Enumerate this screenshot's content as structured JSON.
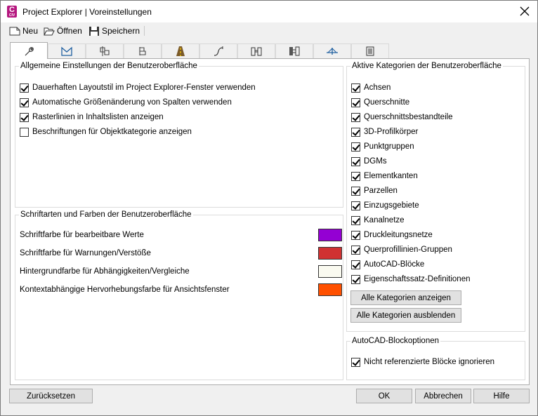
{
  "window": {
    "title": "Project Explorer | Voreinstellungen"
  },
  "toolbar": {
    "new_label": "Neu",
    "open_label": "Öffnen",
    "save_label": "Speichern"
  },
  "general": {
    "legend": "Allgemeine Einstellungen der Benutzeroberfläche",
    "options": [
      {
        "label": "Dauerhaften Layoutstil im Project Explorer-Fenster verwenden",
        "checked": true
      },
      {
        "label": "Automatische Größenänderung von Spalten verwenden",
        "checked": true
      },
      {
        "label": "Rasterlinien in Inhaltslisten anzeigen",
        "checked": true
      },
      {
        "label": "Beschriftungen für Objektkategorie anzeigen",
        "checked": false
      }
    ]
  },
  "fonts_colors": {
    "legend": "Schriftarten und Farben der Benutzeroberfläche",
    "rows": [
      {
        "label": "Schriftfarbe für bearbeitbare Werte",
        "color": "#9400d3"
      },
      {
        "label": "Schriftfarbe für Warnungen/Verstöße",
        "color": "#d03232"
      },
      {
        "label": "Hintergrundfarbe für Abhängigkeiten/Vergleiche",
        "color": "#fafaf0"
      },
      {
        "label": "Kontextabhängige Hervorhebungsfarbe für Ansichtsfenster",
        "color": "#ff5000"
      }
    ]
  },
  "categories": {
    "legend": "Aktive Kategorien der Benutzeroberfläche",
    "items": [
      {
        "label": "Achsen",
        "checked": true
      },
      {
        "label": "Querschnitte",
        "checked": true
      },
      {
        "label": "Querschnittsbestandteile",
        "checked": true
      },
      {
        "label": "3D-Profilkörper",
        "checked": true
      },
      {
        "label": "Punktgruppen",
        "checked": true
      },
      {
        "label": "DGMs",
        "checked": true
      },
      {
        "label": "Elementkanten",
        "checked": true
      },
      {
        "label": "Parzellen",
        "checked": true
      },
      {
        "label": "Einzugsgebiete",
        "checked": true
      },
      {
        "label": "Kanalnetze",
        "checked": true
      },
      {
        "label": "Druckleitungsnetze",
        "checked": true
      },
      {
        "label": "Querprofillinien-Gruppen",
        "checked": true
      },
      {
        "label": "AutoCAD-Blöcke",
        "checked": true
      },
      {
        "label": "Eigenschaftssatz-Definitionen",
        "checked": true
      }
    ],
    "show_all_label": "Alle Kategorien anzeigen",
    "hide_all_label": "Alle Kategorien ausblenden"
  },
  "block_options": {
    "legend": "AutoCAD-Blockoptionen",
    "options": [
      {
        "label": "Nicht referenzierte Blöcke ignorieren",
        "checked": true
      }
    ]
  },
  "footer": {
    "reset_label": "Zurücksetzen",
    "ok_label": "OK",
    "cancel_label": "Abbrechen",
    "help_label": "Hilfe"
  },
  "tabs": [
    {
      "icon": "wrench-icon"
    },
    {
      "icon": "surface-icon"
    },
    {
      "icon": "points-icon"
    },
    {
      "icon": "parcel-icon"
    },
    {
      "icon": "corridor-icon"
    },
    {
      "icon": "alignment-icon"
    },
    {
      "icon": "pipe-network-icon"
    },
    {
      "icon": "pressure-network-icon"
    },
    {
      "icon": "section-icon"
    },
    {
      "icon": "table-icon"
    }
  ]
}
